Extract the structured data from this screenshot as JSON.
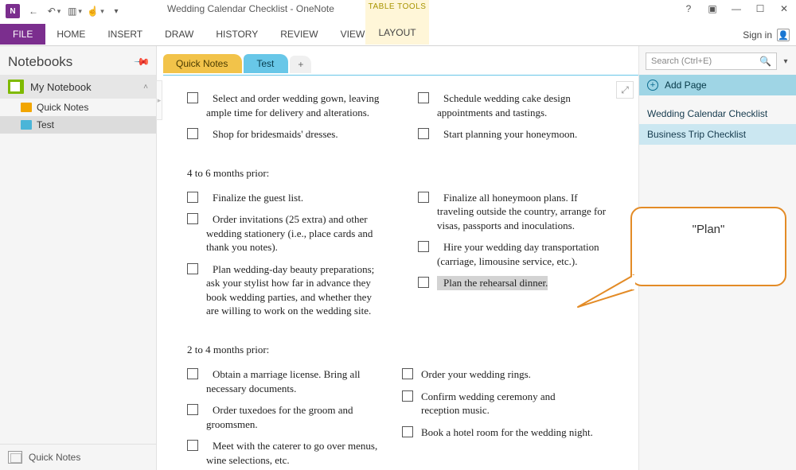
{
  "app": {
    "title": "Wedding Calendar Checklist - OneNote",
    "icon_letter": "N"
  },
  "context_tab": {
    "group": "TABLE TOOLS",
    "label": "LAYOUT"
  },
  "ribbon": {
    "file": "FILE",
    "tabs": [
      "HOME",
      "INSERT",
      "DRAW",
      "HISTORY",
      "REVIEW",
      "VIEW"
    ]
  },
  "signin": {
    "label": "Sign in"
  },
  "help": {
    "q": "?"
  },
  "notebooks": {
    "header": "Notebooks",
    "current": "My Notebook",
    "sections": [
      {
        "label": "Quick Notes",
        "selected": false
      },
      {
        "label": "Test",
        "selected": true
      }
    ],
    "footer": "Quick Notes"
  },
  "page_tabs": {
    "qn": "Quick Notes",
    "test": "Test",
    "new": "+"
  },
  "search": {
    "placeholder": "Search (Ctrl+E)",
    "icon": "🔍"
  },
  "pages_panel": {
    "add": "Add Page",
    "items": [
      {
        "label": "Wedding Calendar Checklist",
        "selected": false
      },
      {
        "label": "Business Trip Checklist",
        "selected": true
      }
    ]
  },
  "content": {
    "sec1_left": [
      "Select and order wedding gown, leaving ample time for delivery and alterations.",
      "Shop for bridesmaids' dresses."
    ],
    "sec1_right": [
      "Schedule wedding cake design appointments and tastings.",
      "Start planning your honeymoon."
    ],
    "hdr2": "4 to 6 months prior:",
    "sec2_left": [
      "Finalize the guest list.",
      "Order invitations (25 extra) and other wedding stationery (i.e., place cards and thank you notes).",
      "Plan wedding-day beauty preparations; ask your stylist how far in advance they book wedding parties, and whether they are willing to work on the wedding site."
    ],
    "sec2_right": [
      "Finalize all honeymoon plans. If traveling outside the country, arrange for visas, passports and inoculations.",
      "Hire your wedding day transportation (carriage, limousine service, etc.).",
      "Plan the rehearsal dinner."
    ],
    "hdr3": "2 to 4 months prior:",
    "sec3_left": [
      "Obtain a marriage license. Bring all necessary documents.",
      "Order tuxedoes for the groom and groomsmen.",
      "Meet with the caterer to go over menus, wine selections, etc."
    ],
    "sec3_right": [
      "Order your wedding rings.",
      "Confirm wedding ceremony and reception music.",
      "Book a hotel room for the wedding night."
    ]
  },
  "callout": {
    "text": "\"Plan\""
  }
}
